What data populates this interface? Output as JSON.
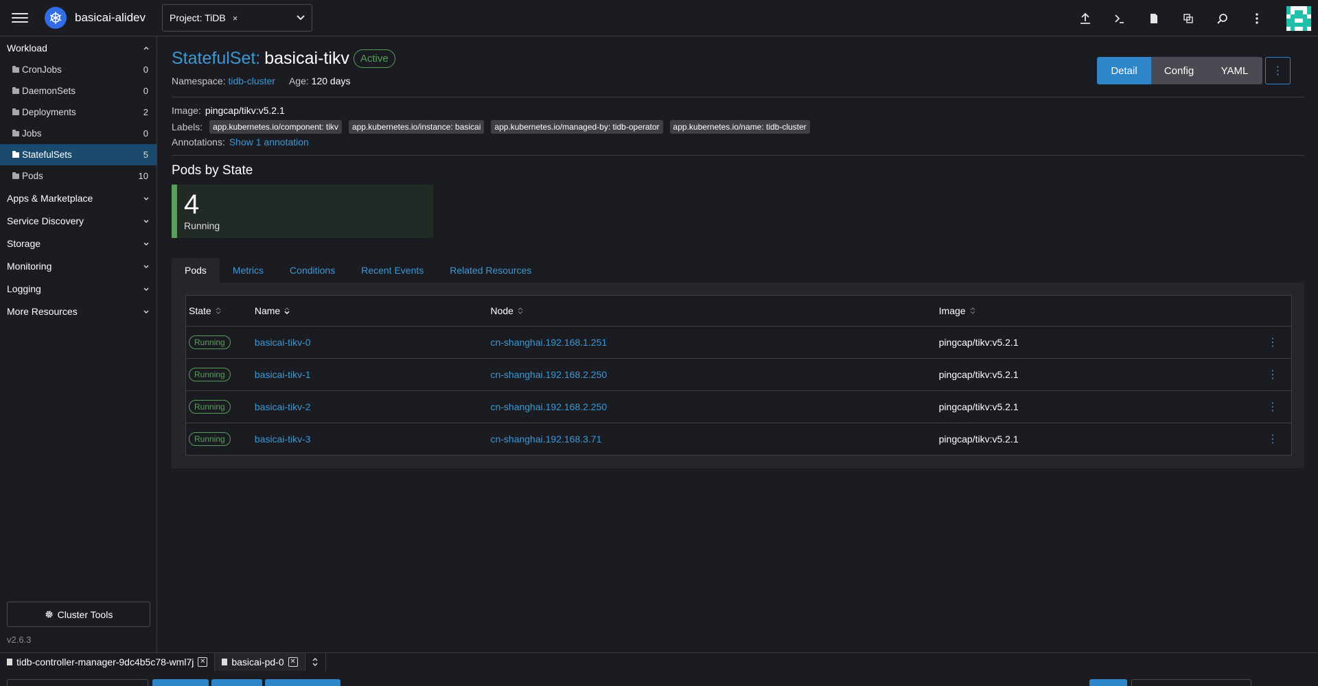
{
  "header": {
    "cluster_name": "basicai-alidev",
    "project_label": "Project: TiDB",
    "project_remove": "×",
    "icons": [
      "upload-icon",
      "terminal-icon",
      "document-icon",
      "copy-icon",
      "search-icon",
      "more-vertical-icon"
    ]
  },
  "sidebar": {
    "workload_label": "Workload",
    "items": [
      {
        "label": "CronJobs",
        "count": "0"
      },
      {
        "label": "DaemonSets",
        "count": "0"
      },
      {
        "label": "Deployments",
        "count": "2"
      },
      {
        "label": "Jobs",
        "count": "0"
      },
      {
        "label": "StatefulSets",
        "count": "5"
      },
      {
        "label": "Pods",
        "count": "10"
      }
    ],
    "groups": [
      "Apps & Marketplace",
      "Service Discovery",
      "Storage",
      "Monitoring",
      "Logging",
      "More Resources"
    ],
    "cluster_tools": "Cluster Tools",
    "version": "v2.6.3"
  },
  "resource": {
    "type": "StatefulSet:",
    "name": "basicai-tikv",
    "status": "Active",
    "namespace_label": "Namespace:",
    "namespace": "tidb-cluster",
    "age_label": "Age:",
    "age": "120 days",
    "image_label": "Image:",
    "image": "pingcap/tikv:v5.2.1",
    "labels_label": "Labels:",
    "labels": [
      "app.kubernetes.io/component: tikv",
      "app.kubernetes.io/instance: basicai",
      "app.kubernetes.io/managed-by: tidb-operator",
      "app.kubernetes.io/name: tidb-cluster"
    ],
    "annotations_label": "Annotations:",
    "annotations_link": "Show 1 annotation"
  },
  "view_buttons": {
    "detail": "Detail",
    "config": "Config",
    "yaml": "YAML",
    "more": "⋮"
  },
  "pods_by_state": {
    "title": "Pods by State",
    "count": "4",
    "state": "Running"
  },
  "tabs": [
    "Pods",
    "Metrics",
    "Conditions",
    "Recent Events",
    "Related Resources"
  ],
  "pods_table": {
    "headers": {
      "state": "State",
      "name": "Name",
      "node": "Node",
      "image": "Image"
    },
    "rows": [
      {
        "state": "Running",
        "name": "basicai-tikv-0",
        "node": "cn-shanghai.192.168.1.251",
        "image": "pingcap/tikv:v5.2.1"
      },
      {
        "state": "Running",
        "name": "basicai-tikv-1",
        "node": "cn-shanghai.192.168.2.250",
        "image": "pingcap/tikv:v5.2.1"
      },
      {
        "state": "Running",
        "name": "basicai-tikv-2",
        "node": "cn-shanghai.192.168.2.250",
        "image": "pingcap/tikv:v5.2.1"
      },
      {
        "state": "Running",
        "name": "basicai-tikv-3",
        "node": "cn-shanghai.192.168.3.71",
        "image": "pingcap/tikv:v5.2.1"
      }
    ],
    "row_menu": "⋮"
  },
  "bottom_tabs": [
    {
      "label": "tidb-controller-manager-9dc4b5c78-wml7j"
    },
    {
      "label": "basicai-pd-0"
    }
  ],
  "colors": {
    "accent": "#3d98d3",
    "primary_button": "#2e86c9",
    "running": "#5a9e5c",
    "active_nav": "#1a4a6e"
  }
}
